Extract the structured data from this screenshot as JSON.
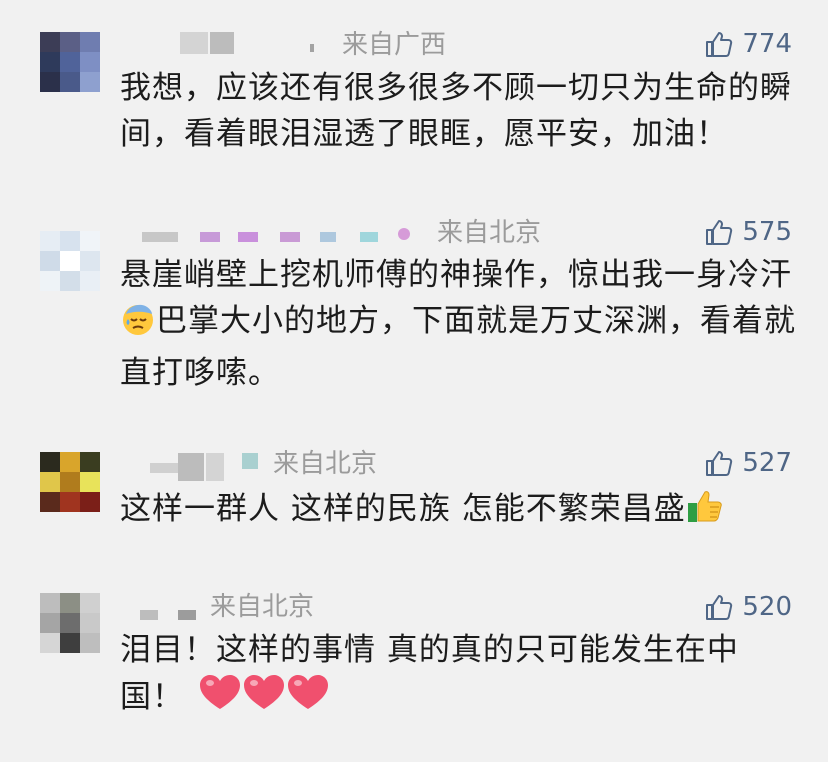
{
  "comments": [
    {
      "location": "来自广西",
      "likes": "774",
      "text": "我想，应该还有很多很多不顾一切只为生命的瞬间，看着眼泪湿透了眼眶，愿平安，加油！",
      "avatar_colors": [
        "#3c3d56",
        "#5b5f86",
        "#6f7db0",
        "#2e3a5b",
        "#50639a",
        "#7e8fc4",
        "#2b304a",
        "#4a5a8a",
        "#8ea0cf"
      ]
    },
    {
      "location": "来自北京",
      "likes": "575",
      "text_before": "悬崖峭壁上挖机师傅的神操作，惊出我一身冷汗",
      "text_after": "巴掌大小的地方，下面就是万丈深渊，看着就直打哆嗦。",
      "emoji": "sweat-face-icon",
      "avatar_colors": [
        "#e6edf4",
        "#d7e2ee",
        "#f0f4f8",
        "#cfdbe8",
        "#ffffff",
        "#dde6ef",
        "#eef3f7",
        "#d3dee9",
        "#e9eff5"
      ]
    },
    {
      "location": "来自北京",
      "likes": "527",
      "text": "这样一群人 这样的民族 怎能不繁荣昌盛",
      "emoji": "thumbs-up-emoji-icon",
      "avatar_colors": [
        "#2b2a1e",
        "#d9a52b",
        "#3a3d20",
        "#e0c64a",
        "#b07c1d",
        "#e8e35a",
        "#5a2a1c",
        "#a0341f",
        "#7b1f18"
      ]
    },
    {
      "location": "来自北京",
      "likes": "520",
      "text": "泪目！这样的事情 真的真的只可能发生在中国！",
      "emoji": "hearts-icon",
      "avatar_colors": [
        "#bdbdbd",
        "#8c8f85",
        "#d0d0d0",
        "#a5a5a5",
        "#6d6d6d",
        "#c9c9c9",
        "#d6d6d6",
        "#3e3e3e",
        "#bebebe"
      ]
    }
  ]
}
